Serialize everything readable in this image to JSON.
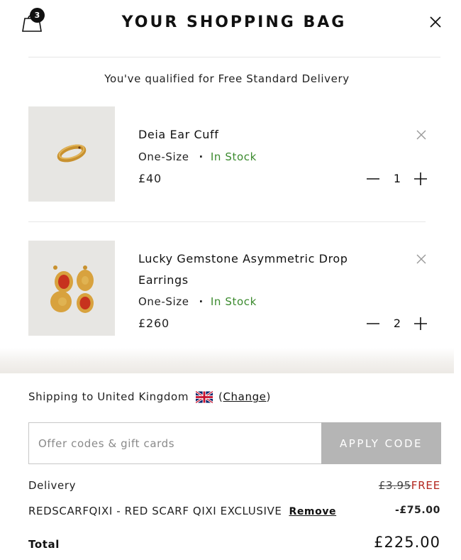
{
  "header": {
    "title": "YOUR SHOPPING BAG",
    "bag_count": "3"
  },
  "free_delivery_message": "You've qualified for Free Standard Delivery",
  "items": [
    {
      "name": "Deia Ear Cuff",
      "size": "One-Size",
      "stock": "In Stock",
      "price": "£40",
      "quantity": "1"
    },
    {
      "name_line1": "Lucky Gemstone Asymmetric Drop",
      "name_line2": "Earrings",
      "size": "One-Size",
      "stock": "In Stock",
      "price": "£260",
      "quantity": "2"
    }
  ],
  "shipping": {
    "text": "Shipping to United Kingdom",
    "open_paren": "(",
    "change_label": "Change",
    "close_paren": ")"
  },
  "promo": {
    "placeholder": "Offer codes & gift cards",
    "apply_label": "APPLY CODE"
  },
  "summary": {
    "delivery_label": "Delivery",
    "delivery_old": "£3.95",
    "delivery_new": "FREE",
    "discount_label": "REDSCARFQIXI - RED SCARF QIXI EXCLUSIVE",
    "discount_remove": "Remove",
    "discount_value": "-£75.00",
    "total_label": "Total",
    "total_value": "£225.00"
  },
  "colors": {
    "in_stock": "#3b8a2e",
    "free": "#b3261e",
    "apply_button": "#b5b5b5"
  }
}
